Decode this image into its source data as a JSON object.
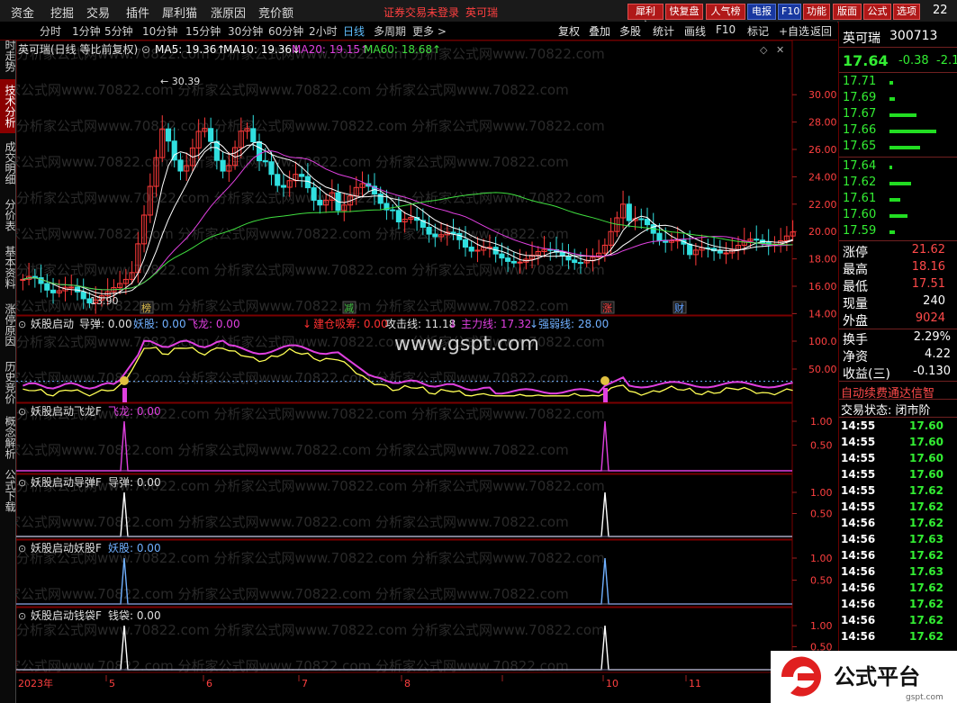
{
  "menu": {
    "items": [
      "资金",
      "挖掘",
      "交易",
      "插件",
      "犀利猫",
      "涨原因",
      "竞价额"
    ],
    "alert": "证券交易未登录",
    "stock_link": "英可瑞",
    "tool_buttons": [
      "犀利宝",
      "快复盘",
      "人气榜",
      "电报",
      "F10",
      "功能",
      "版面",
      "公式",
      "选项"
    ],
    "clock": "22"
  },
  "periods": {
    "items": [
      "分时",
      "1分钟",
      "5分钟",
      "10分钟",
      "15分钟",
      "30分钟",
      "60分钟",
      "2小时",
      "日线",
      "多周期",
      "更多 >"
    ],
    "selected": "日线",
    "right": [
      "复权",
      "叠加",
      "多股",
      "统计",
      "画线",
      "F10",
      "标记",
      "+自选",
      "返回"
    ]
  },
  "left_tabs": [
    "分时走势",
    "技术分析",
    "成交明细",
    "分价表",
    "基本资料",
    "涨停原因",
    "历史竞价",
    "概念解析",
    "公式下载"
  ],
  "left_tab_active": "技术分析",
  "main_chart": {
    "title": "英可瑞(日线 等比前复权)",
    "ma": [
      {
        "label": "MA5: 19.36↑",
        "color": "#ffffff"
      },
      {
        "label": "MA10: 19.36↓",
        "color": "#ffffff"
      },
      {
        "label": "MA20: 19.15↑",
        "color": "#e040e0"
      },
      {
        "label": "MA60: 18.68↑",
        "color": "#40e040"
      }
    ],
    "high_label": "30.39",
    "low_label": "13.90",
    "y_ticks": [
      "30.00",
      "28.00",
      "26.00",
      "24.00",
      "22.00",
      "20.00",
      "18.00",
      "16.00",
      "14.00"
    ],
    "markers": [
      {
        "text": "榜",
        "color": "#e0c050"
      },
      {
        "text": "减",
        "color": "#40c040"
      },
      {
        "text": "涨",
        "color": "#ff4040"
      },
      {
        "text": "财",
        "color": "#60a0ff"
      }
    ]
  },
  "indicator1": {
    "name": "妖股启动",
    "items": [
      {
        "label": "导弹: 0.00",
        "color": "#e0e0e0"
      },
      {
        "label": "妖股: 0.00",
        "color": "#70b0ff"
      },
      {
        "label": "飞龙: 0.00",
        "color": "#e040e0"
      },
      {
        "label": "建仓吸筹: 0.00",
        "color": "#ff3030"
      },
      {
        "label": "攻击线: 11.18",
        "color": "#e0e0e0"
      },
      {
        "label": "主力线: 17.32",
        "color": "#e040e0"
      },
      {
        "label": "强弱线: 28.00",
        "color": "#70b0ff"
      }
    ],
    "y_ticks": [
      "100.0",
      "50.00"
    ],
    "watermark": "www.gspt.com"
  },
  "sub_panels": [
    {
      "name": "妖股启动飞龙F",
      "value": "飞龙: 0.00",
      "color": "#e040e0"
    },
    {
      "name": "妖股启动导弹F",
      "value": "导弹: 0.00",
      "color": "#e0e0e0"
    },
    {
      "name": "妖股启动妖股F",
      "value": "妖股: 0.00",
      "color": "#70b0ff"
    },
    {
      "name": "妖股启动钱袋F",
      "value": "钱袋: 0.00",
      "color": "#e0e0e0"
    }
  ],
  "sub_y_ticks": [
    "1.00",
    "0.50"
  ],
  "x_axis": {
    "year": "2023年",
    "months": [
      "5",
      "6",
      "7",
      "8",
      "",
      "10",
      "11"
    ]
  },
  "watermark_text": "分析家公式网www.70822.com",
  "quote": {
    "name": "英可瑞",
    "code": "300713",
    "price": "17.64",
    "change": "-0.38",
    "pct": "-2.1",
    "asks": [
      {
        "p": "17.71",
        "v": ""
      },
      {
        "p": "17.69",
        "v": ""
      },
      {
        "p": "17.67",
        "v": ""
      },
      {
        "p": "17.66",
        "v": ""
      },
      {
        "p": "17.65",
        "v": ""
      }
    ],
    "bids": [
      {
        "p": "17.64",
        "v": ""
      },
      {
        "p": "17.62",
        "v": ""
      },
      {
        "p": "17.61",
        "v": ""
      },
      {
        "p": "17.60",
        "v": ""
      },
      {
        "p": "17.59",
        "v": ""
      }
    ],
    "stats": [
      {
        "k": "涨停",
        "v": "21.62",
        "c": "red"
      },
      {
        "k": "最高",
        "v": "18.16",
        "c": "red"
      },
      {
        "k": "最低",
        "v": "17.51",
        "c": "red"
      },
      {
        "k": "现量",
        "v": "240",
        "c": "white"
      },
      {
        "k": "外盘",
        "v": "9024",
        "c": "red"
      }
    ],
    "stats2": [
      {
        "k": "换手",
        "v": "2.29%",
        "c": "white"
      },
      {
        "k": "净资",
        "v": "4.22",
        "c": "white"
      },
      {
        "k": "收益(三)",
        "v": "-0.130",
        "c": "white"
      }
    ],
    "notice": "自动续费通达信智",
    "status": "交易状态: 闭市阶",
    "ticks": [
      [
        "14:55",
        "17.60"
      ],
      [
        "14:55",
        "17.60"
      ],
      [
        "14:55",
        "17.60"
      ],
      [
        "14:55",
        "17.60"
      ],
      [
        "14:55",
        "17.62"
      ],
      [
        "14:55",
        "17.62"
      ],
      [
        "14:56",
        "17.62"
      ],
      [
        "14:56",
        "17.63"
      ],
      [
        "14:56",
        "17.62"
      ],
      [
        "14:56",
        "17.63"
      ],
      [
        "14:56",
        "17.62"
      ],
      [
        "14:56",
        "17.62"
      ],
      [
        "14:56",
        "17.62"
      ],
      [
        "14:56",
        "17.62"
      ]
    ]
  },
  "badge": {
    "text": "公式平台",
    "sub": "gspt.com"
  }
}
